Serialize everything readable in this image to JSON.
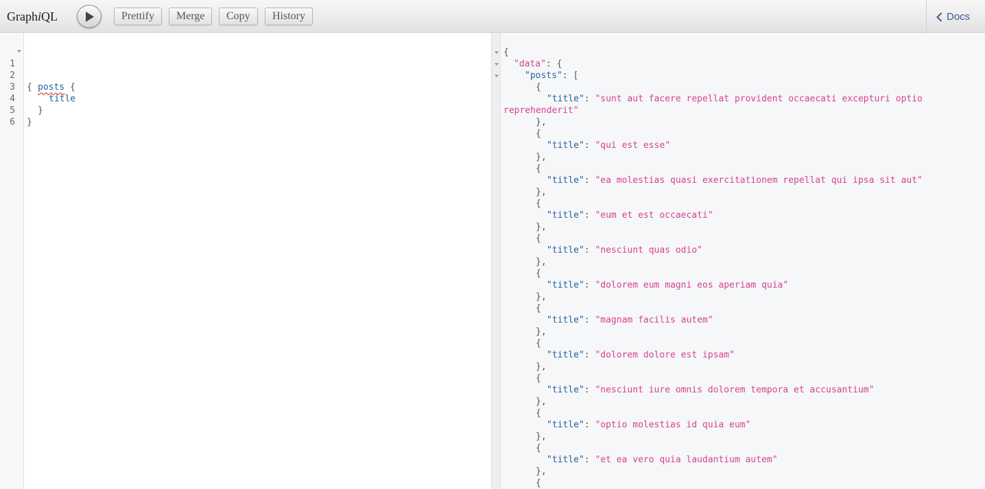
{
  "app": {
    "title_pre": "Graph",
    "title_i": "i",
    "title_post": "QL"
  },
  "toolbar": {
    "prettify": "Prettify",
    "merge": "Merge",
    "copy": "Copy",
    "history": "History",
    "docs": "Docs"
  },
  "query": {
    "line_numbers": [
      "1",
      "2",
      "3",
      "4",
      "5",
      "6"
    ],
    "open_brace": "{",
    "field_posts": "posts",
    "posts_brace": " {",
    "field_title": "title",
    "close_inner": "}",
    "close_outer": "}"
  },
  "result": {
    "open": "{",
    "data_key": "\"data\"",
    "data_sep": ": {",
    "posts_key": "\"posts\"",
    "posts_sep": ": [",
    "title_key": "\"title\"",
    "colon": ": ",
    "obj_open": "{",
    "obj_close": "},",
    "titles": [
      "\"sunt aut facere repellat provident occaecati excepturi optio",
      "reprehenderit\"",
      "\"qui est esse\"",
      "\"ea molestias quasi exercitationem repellat qui ipsa sit aut\"",
      "\"eum et est occaecati\"",
      "\"nesciunt quas odio\"",
      "\"dolorem eum magni eos aperiam quia\"",
      "\"magnam facilis autem\"",
      "\"dolorem dolore est ipsam\"",
      "\"nesciunt iure omnis dolorem tempora et accusantium\"",
      "\"optio molestias id quia eum\"",
      "\"et ea vero quia laudantium autem\""
    ]
  }
}
